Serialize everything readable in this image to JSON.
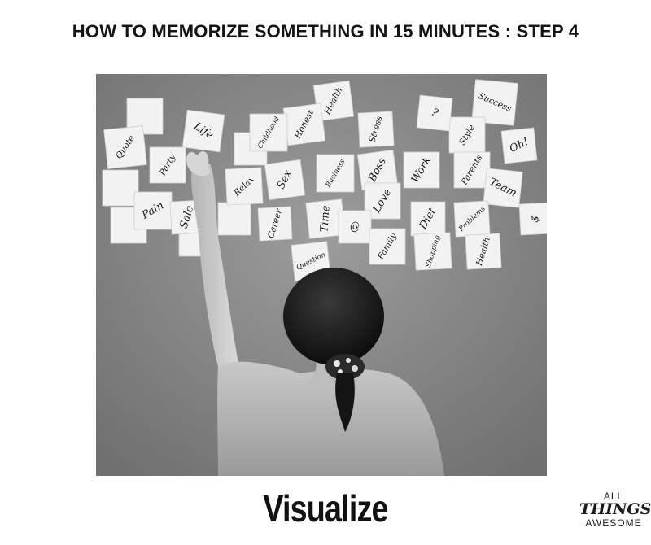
{
  "title": "HOW TO MEMORIZE SOMETHING IN 15 MINUTES : STEP 4",
  "caption": "Visualize",
  "logo": {
    "line1": "ALL",
    "line2": "THINGS",
    "line3": "AWESOME"
  },
  "notes": [
    "Success",
    "Health",
    "Style",
    "?",
    "Stress",
    "Oh!",
    "Honest",
    "Childhood",
    "Life",
    "Quote",
    "Party",
    "Work",
    "Parents",
    "Relax",
    "Sex",
    "Business",
    "Boss",
    "Team",
    "Pain",
    "Sale",
    "Love",
    "Diet",
    "Problems",
    "$",
    "Career",
    "Time",
    "@",
    "Family",
    "Shopping",
    "Health",
    "Question"
  ]
}
